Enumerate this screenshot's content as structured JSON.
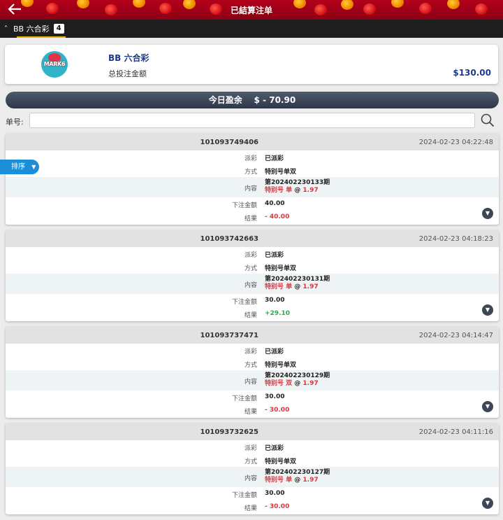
{
  "header": {
    "title": "已結算注单",
    "back_icon": "arrow-left-icon"
  },
  "tab": {
    "label": "BB 六合彩",
    "count": "4"
  },
  "summary": {
    "logo_text": "MARK6",
    "name": "BB 六合彩",
    "total_label": "总投注金额",
    "total_amount": "$130.00"
  },
  "profit": {
    "label": "今日盈余",
    "value": "$ - 70.90"
  },
  "search": {
    "label": "单号:",
    "value": "",
    "placeholder": ""
  },
  "sort": {
    "label": "排序",
    "arrow": "▼"
  },
  "labels": {
    "status": "派彩",
    "method": "方式",
    "content": "内容",
    "amount": "下注金额",
    "result": "结果"
  },
  "records": [
    {
      "id": "101093749406",
      "time": "2024-02-23 04:22:48",
      "status": "已派彩",
      "method": "特别号单双",
      "content_line1": "第202402230133期",
      "content_line2_prefix": "特别号 单",
      "content_odds_at": " @ ",
      "content_odds": "1.97",
      "amount": "40.00",
      "result": "- 40.00",
      "result_type": "loss"
    },
    {
      "id": "101093742663",
      "time": "2024-02-23 04:18:23",
      "status": "已派彩",
      "method": "特别号单双",
      "content_line1": "第202402230131期",
      "content_line2_prefix": "特别号 单",
      "content_odds_at": " @ ",
      "content_odds": "1.97",
      "amount": "30.00",
      "result": "+29.10",
      "result_type": "win"
    },
    {
      "id": "101093737471",
      "time": "2024-02-23 04:14:47",
      "status": "已派彩",
      "method": "特别号单双",
      "content_line1": "第202402230129期",
      "content_line2_prefix": "特别号 双",
      "content_odds_at": " @ ",
      "content_odds": "1.97",
      "amount": "30.00",
      "result": "- 30.00",
      "result_type": "loss"
    },
    {
      "id": "101093732625",
      "time": "2024-02-23 04:11:16",
      "status": "已派彩",
      "method": "特别号单双",
      "content_line1": "第202402230127期",
      "content_line2_prefix": "特别号 单",
      "content_odds_at": " @ ",
      "content_odds": "1.97",
      "amount": "30.00",
      "result": "- 30.00",
      "result_type": "loss"
    }
  ],
  "colors": {
    "banner": "#b3001b",
    "accent_blue": "#1d3a8a",
    "loss": "#d9363e",
    "win": "#2ea84f",
    "sort_button": "#1a8fd8"
  }
}
